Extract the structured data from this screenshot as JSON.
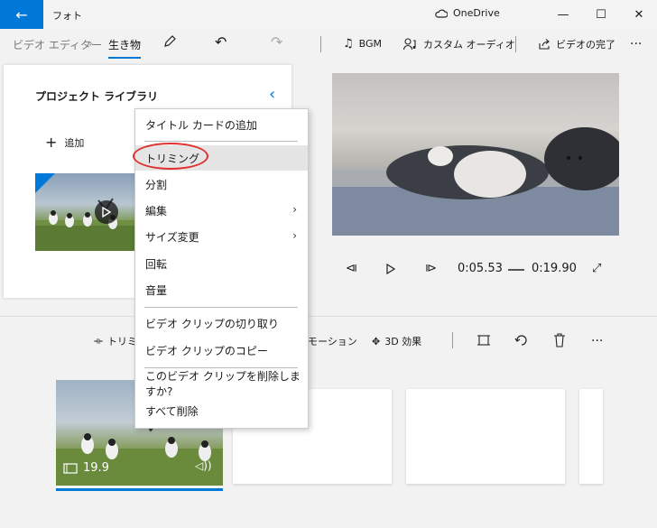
{
  "window": {
    "app_title": "フォト",
    "onedrive_label": "OneDrive",
    "minimize": "—",
    "maximize": "☐",
    "close": "✕",
    "back": "←"
  },
  "breadcrumb": {
    "parent": "ビデオ エディター",
    "current": "生き物"
  },
  "commands": {
    "bgm": "BGM",
    "custom_audio": "カスタム オーディオ",
    "finish_video": "ビデオの完了",
    "more": "···"
  },
  "library": {
    "title": "プロジェクト ライブラリ",
    "add": "追加"
  },
  "playback": {
    "current_time": "0:05.53",
    "total_time": "0:19.90"
  },
  "storyboard_toolbar": {
    "trim": "トリミ",
    "motion": "モーション",
    "effects_3d": "3D 効果",
    "more": "···"
  },
  "storyboard": {
    "clip_duration": "19.9"
  },
  "context_menu": {
    "items": [
      {
        "label": "タイトル カードの追加"
      },
      {
        "label": "トリミング"
      },
      {
        "label": "分割"
      },
      {
        "label": "編集"
      },
      {
        "label": "サイズ変更"
      },
      {
        "label": "回転"
      },
      {
        "label": "音量"
      },
      {
        "label": "ビデオ クリップの切り取り"
      },
      {
        "label": "ビデオ クリップのコピー"
      },
      {
        "label": "このビデオ クリップを削除しますか?"
      },
      {
        "label": "すべて削除"
      }
    ]
  },
  "colors": {
    "accent": "#0078d7",
    "annotation": "#e03030"
  }
}
